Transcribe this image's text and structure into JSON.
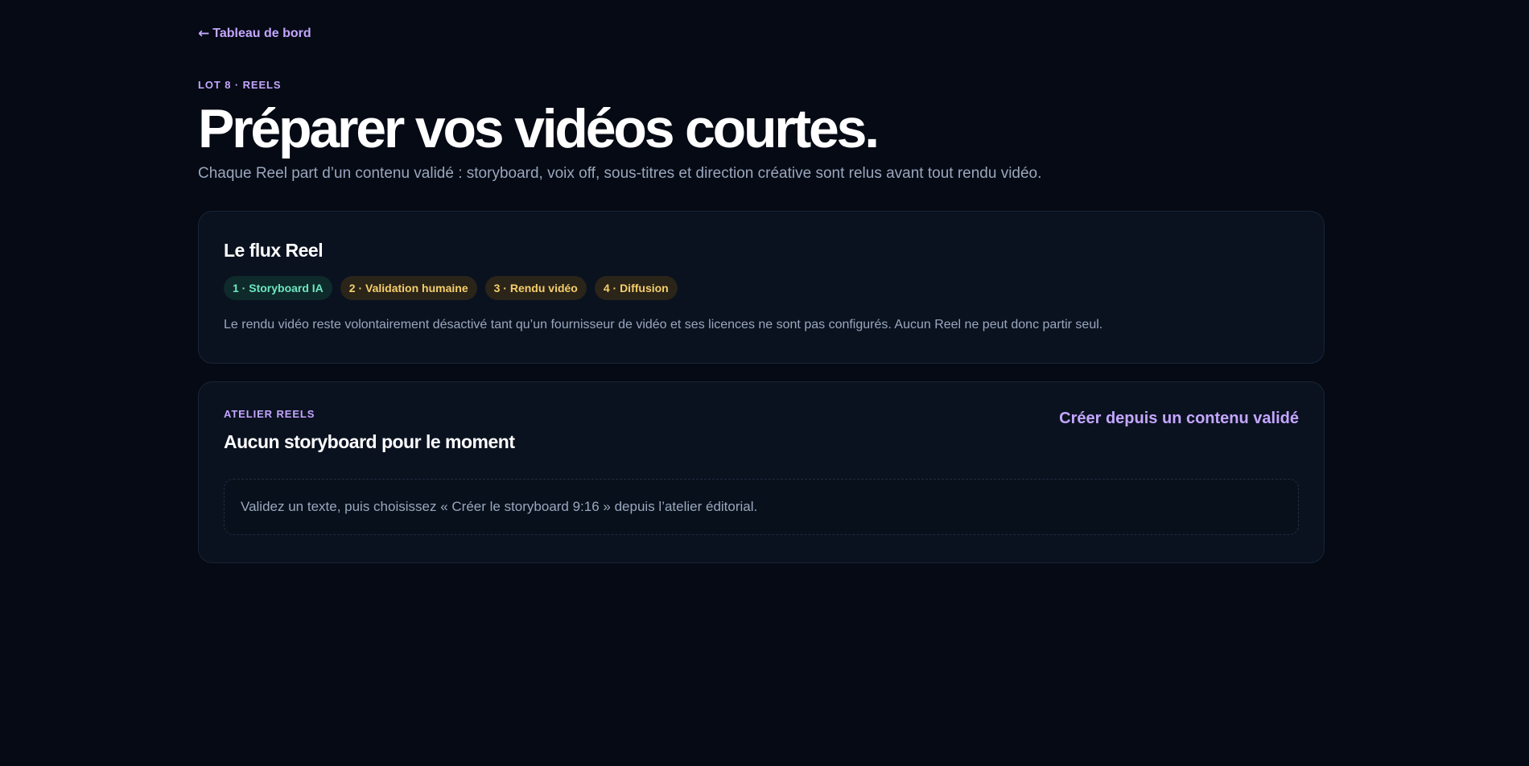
{
  "nav": {
    "back_arrow": "←",
    "back_label": "Tableau de bord"
  },
  "hero": {
    "eyebrow": "LOT 8 · REELS",
    "title": "Préparer vos vidéos courtes.",
    "subtitle": "Chaque Reel part d’un contenu validé : storyboard, voix off, sous-titres et direction créative sont relus avant tout rendu vidéo."
  },
  "flow": {
    "title": "Le flux Reel",
    "steps": [
      {
        "label": "1 · Storyboard IA",
        "status_color": "#6ee7c2"
      },
      {
        "label": "2 · Validation humaine",
        "status_color": "#f5cf6b"
      },
      {
        "label": "3 · Rendu vidéo",
        "status_color": "#f5cf6b"
      },
      {
        "label": "4 · Diffusion",
        "status_color": "#f5cf6b"
      }
    ],
    "note": "Le rendu vidéo reste volontairement désactivé tant qu’un fournisseur de vidéo et ses licences ne sont pas configurés. Aucun Reel ne peut donc partir seul."
  },
  "workshop": {
    "eyebrow": "ATELIER REELS",
    "title": "Aucun storyboard pour le moment",
    "create_label": "Créer depuis un contenu validé",
    "empty_message": "Validez un texte, puis choisissez « Créer le storyboard 9:16 » depuis l’atelier éditorial."
  },
  "colors": {
    "background": "#050a14",
    "accent": "#c4a6ff",
    "card": "#0a1220"
  }
}
